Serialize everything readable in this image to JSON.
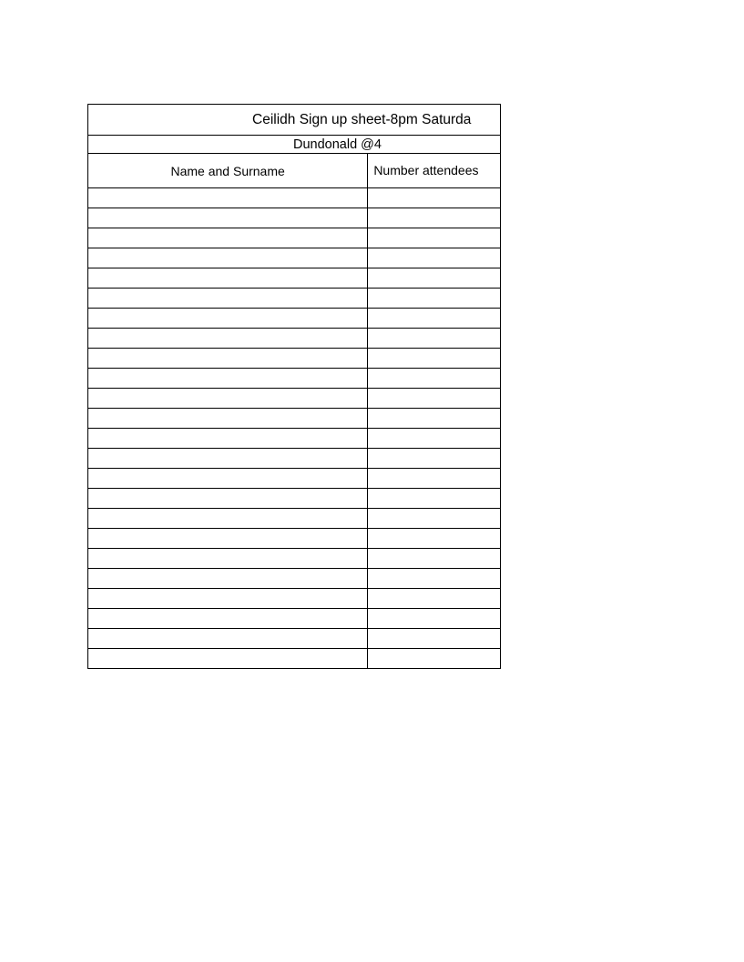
{
  "sheet": {
    "title": "Ceilidh Sign up sheet-8pm Saturda",
    "subtitle": "Dundonald @4",
    "headers": {
      "name": "Name and Surname",
      "number": "Number attendees"
    },
    "row_count": 24
  }
}
